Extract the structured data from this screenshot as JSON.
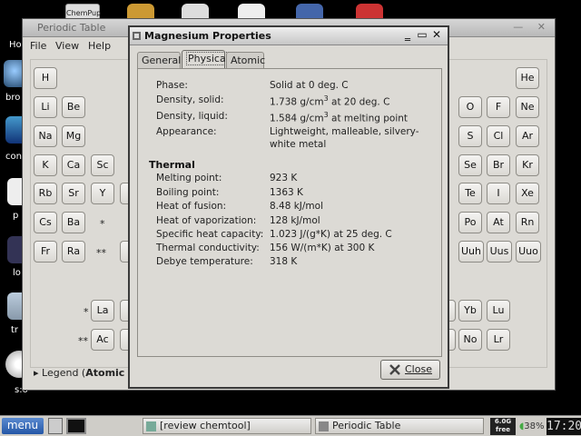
{
  "desktop": {
    "labels": [
      "Ho",
      "bro",
      "con",
      "p",
      "lo",
      "tr",
      "s:o"
    ],
    "top_icons": [
      "ChemPup"
    ]
  },
  "main_window": {
    "title": "Periodic Table",
    "menu": [
      "File",
      "View",
      "Help"
    ],
    "elements": [
      "H",
      "He",
      "Li",
      "Be",
      "O",
      "F",
      "Ne",
      "Na",
      "Mg",
      "S",
      "Cl",
      "Ar",
      "K",
      "Ca",
      "Sc",
      "Se",
      "Br",
      "Kr",
      "Rb",
      "Sr",
      "Y",
      "Te",
      "I",
      "Xe",
      "Cs",
      "Ba",
      "Po",
      "At",
      "Rn",
      "Fr",
      "Ra",
      "Uuh",
      "Uus",
      "Uuo",
      "La",
      "Yb",
      "Lu",
      "Ac",
      "No",
      "Lr"
    ],
    "stars": [
      "*",
      "**",
      "*",
      "**"
    ],
    "legend_prefix": "Legend (",
    "legend_bold": "Atomic"
  },
  "dialog": {
    "title": "Magnesium Properties",
    "tabs": [
      "General",
      "Physical",
      "Atomic"
    ],
    "active_tab": "Physical",
    "properties": [
      {
        "label": "Phase:",
        "value": "Solid at 0 deg. C"
      },
      {
        "label": "Density, solid:",
        "value_pre": "1.738 g/cm",
        "sup": "3",
        "value_post": " at 20 deg. C"
      },
      {
        "label": "Density, liquid:",
        "value_pre": "1.584 g/cm",
        "sup": "3",
        "value_post": " at melting point"
      },
      {
        "label": "Appearance:",
        "value": "Lightweight, malleable, silvery-",
        "value2": "white metal"
      }
    ],
    "thermal_heading": "Thermal",
    "thermal": [
      {
        "label": "Melting point:",
        "value": "923 K"
      },
      {
        "label": "Boiling point:",
        "value": "1363 K"
      },
      {
        "label": "Heat of fusion:",
        "value": "8.48 kJ/mol"
      },
      {
        "label": "Heat of vaporization:",
        "value": "128 kJ/mol"
      },
      {
        "label": "Specific heat capacity:",
        "value": "1.023 J/(g*K) at 25 deg. C"
      },
      {
        "label": "Thermal conductivity:",
        "value": "156 W/(m*K) at 300 K"
      },
      {
        "label": "Debye temperature:",
        "value": "318 K"
      }
    ],
    "close_label": "Close"
  },
  "taskbar": {
    "menu_label": "menu",
    "tasks": [
      "[review chemtool]",
      "Periodic Table"
    ],
    "disk_line1": "6.0G",
    "disk_line2": "free",
    "battery": "38%",
    "clock": "17:20"
  },
  "colors": {
    "menu_button": "#2457a6",
    "dialog_border": "#3a3a3a"
  }
}
